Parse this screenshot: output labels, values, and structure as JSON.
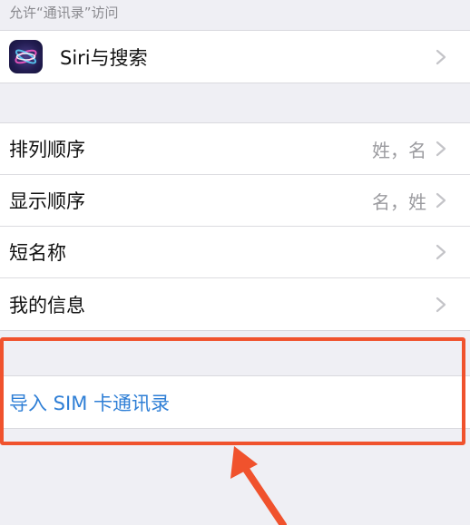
{
  "section_header": "允许“通讯录”访问",
  "siri_row": {
    "label": "Siri与搜索",
    "icon": "siri-icon"
  },
  "settings": [
    {
      "name": "sort-order",
      "label": "排列顺序",
      "value": "姓，名"
    },
    {
      "name": "display-order",
      "label": "显示顺序",
      "value": "名，姓"
    },
    {
      "name": "short-name",
      "label": "短名称",
      "value": ""
    },
    {
      "name": "my-info",
      "label": "我的信息",
      "value": ""
    }
  ],
  "import_sim": {
    "label": "导入 SIM 卡通讯录"
  },
  "colors": {
    "link": "#2f7fd6",
    "highlight": "#f0522d",
    "background": "#efeff4"
  }
}
